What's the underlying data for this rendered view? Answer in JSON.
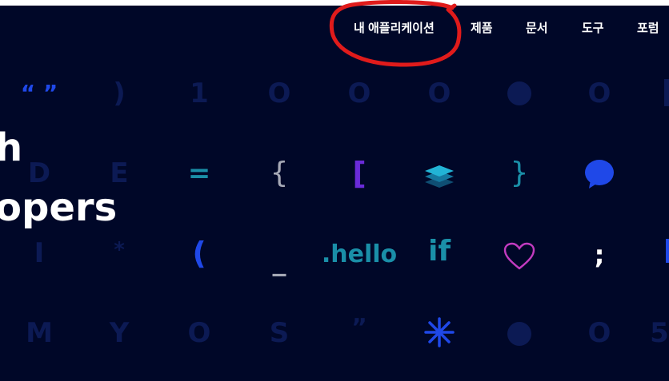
{
  "nav": {
    "my_apps": "내 애플리케이션",
    "products": "제품",
    "docs": "문서",
    "tools": "도구",
    "forum": "포럼"
  },
  "hero": {
    "headline_line1": "h",
    "headline_line2": "opers"
  },
  "symbols": {
    "quotes": "“ ”",
    "paren_close": ")",
    "one": "1",
    "o1": "O",
    "o2": "O",
    "o3": "O",
    "o4": "O",
    "d": "D",
    "e": "E",
    "equals": "=",
    "brace_open": "{",
    "bracket_open": "[",
    "brace_close": "}",
    "pipe": "I",
    "asterisk_small": "*",
    "paren_open": "(",
    "underscore": "_",
    "hello": ".hello",
    "if": "if",
    "semicolon": ";",
    "m": "M",
    "y": "Y",
    "o5": "O",
    "s": "S",
    "closing_quote": "”",
    "o6": "O",
    "five": "5"
  },
  "colors": {
    "background": "#000728",
    "dim_symbol": "#0c1a54",
    "blue": "#1f48e8",
    "teal": "#1a8fa8",
    "purple": "#6a2bd9",
    "magenta": "#c23bc0",
    "highlight_ring": "#e01b1b"
  },
  "icons": [
    "layers-icon",
    "chat-bubble-icon",
    "heart-icon",
    "sparkle-asterisk-icon"
  ]
}
